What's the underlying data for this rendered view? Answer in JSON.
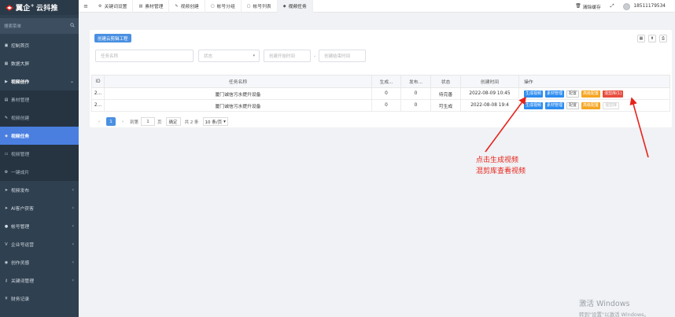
{
  "brand": {
    "name": "翼企",
    "suffix": "云抖推",
    "plus": "+"
  },
  "sidebar": {
    "search_placeholder": "搜索菜单",
    "items": [
      {
        "label": "控制首页",
        "icon": "dashboard-icon"
      },
      {
        "label": "数据大屏",
        "icon": "chart-icon"
      },
      {
        "label": "视频创作",
        "icon": "video-icon",
        "open": true
      },
      {
        "label": "素材管理",
        "icon": "folder-icon",
        "sub": true
      },
      {
        "label": "视频创建",
        "icon": "pencil-icon",
        "sub": true
      },
      {
        "label": "视频任务",
        "icon": "tag-icon",
        "sub": true,
        "active": true
      },
      {
        "label": "视频管理",
        "icon": "film-icon",
        "sub": true
      },
      {
        "label": "一键成片",
        "icon": "gear-icon",
        "sub": true
      },
      {
        "label": "视频发布",
        "icon": "send-icon"
      },
      {
        "label": "AI客户获客",
        "icon": "send-icon"
      },
      {
        "label": "帐号管理",
        "icon": "users-icon"
      },
      {
        "label": "企业号运营",
        "icon": "v-icon"
      },
      {
        "label": "创作灵感",
        "icon": "bulb-icon"
      },
      {
        "label": "关键词管理",
        "icon": "key-icon"
      },
      {
        "label": "财务记录",
        "icon": "yen-icon"
      }
    ]
  },
  "topbar": {
    "tabs": [
      {
        "label": "关键词设置",
        "icon": "gear-icon"
      },
      {
        "label": "素材管理",
        "icon": "image-icon"
      },
      {
        "label": "视频创建",
        "icon": "pencil-icon"
      },
      {
        "label": "帐号分组",
        "icon": "user-icon"
      },
      {
        "label": "帐号列表",
        "icon": "user-icon"
      },
      {
        "label": "视频任务",
        "icon": "tag-icon",
        "active": true
      }
    ],
    "clear_cache": "清除缓存",
    "phone": "18511179534"
  },
  "panel": {
    "create_button": "创建云剪辑工程",
    "filters": {
      "task_name_placeholder": "任务名称",
      "status_placeholder": "状态",
      "start_placeholder": "创建开始时间",
      "end_placeholder": "创建结束时间",
      "dash": "-"
    },
    "table": {
      "headers": [
        "ID",
        "任务名称",
        "生成...",
        "发布...",
        "状态",
        "创建时间",
        "操作"
      ],
      "rows": [
        {
          "id": "2...",
          "name": "厦门诚信污水提升设备",
          "gen": "0",
          "pub": "0",
          "status": "待完善",
          "created": "2022-08-09 10:45",
          "ops": [
            "生成视频",
            "素材管理",
            "配置",
            "高级配置",
            "混剪库(1)"
          ]
        },
        {
          "id": "2...",
          "name": "厦门诚信污水提升设备",
          "gen": "0",
          "pub": "0",
          "status": "可生成",
          "created": "2022-08-08 19:4",
          "ops": [
            "生成视频",
            "素材管理",
            "配置",
            "高级配置",
            "混剪库"
          ]
        }
      ]
    },
    "pager": {
      "prev": "‹",
      "page": "1",
      "next": "›",
      "goto": "到第",
      "input": "1",
      "page_unit": "页",
      "confirm": "确定",
      "total": "共 2 条",
      "per_page": "10 条/页"
    }
  },
  "annotation": {
    "line1": "点击生成视频",
    "line2": "混剪库查看视频",
    "color": "#e8231a"
  },
  "watermark": {
    "line1": "激活 Windows",
    "line2": "转到\"设置\"以激活 Windows。"
  }
}
